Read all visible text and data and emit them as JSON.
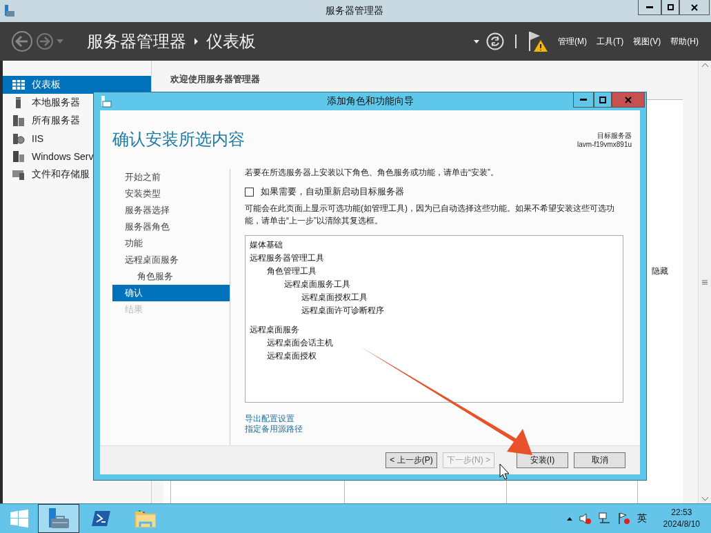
{
  "window": {
    "title": "服务器管理器"
  },
  "header": {
    "breadcrumb": [
      "服务器管理器",
      "仪表板"
    ],
    "menu": [
      "管理(M)",
      "工具(T)",
      "视图(V)",
      "帮助(H)"
    ]
  },
  "sidebar": {
    "items": [
      {
        "label": "仪表板",
        "kind": "dashboard",
        "selected": true
      },
      {
        "label": "本地服务器",
        "kind": "server",
        "selected": false
      },
      {
        "label": "所有服务器",
        "kind": "servers",
        "selected": false
      },
      {
        "label": "IIS",
        "kind": "iis",
        "selected": false
      },
      {
        "label": "Windows Serv",
        "kind": "roles",
        "selected": false
      },
      {
        "label": "文件和存储服",
        "kind": "storage",
        "selected": false
      }
    ]
  },
  "content": {
    "welcome": "欢迎使用服务器管理器",
    "hide_label": "隐藏"
  },
  "dialog": {
    "title": "添加角色和功能向导",
    "heading": "确认安装所选内容",
    "target_label": "目标服务器",
    "target_name": "lavm-f19vmx891u",
    "steps": [
      {
        "label": "开始之前",
        "selected": false,
        "disabled": false
      },
      {
        "label": "安装类型",
        "selected": false,
        "disabled": false
      },
      {
        "label": "服务器选择",
        "selected": false,
        "disabled": false
      },
      {
        "label": "服务器角色",
        "selected": false,
        "disabled": false
      },
      {
        "label": "功能",
        "selected": false,
        "disabled": false
      },
      {
        "label": "远程桌面服务",
        "selected": false,
        "disabled": false,
        "children": [
          {
            "label": "角色服务",
            "selected": false,
            "disabled": false
          }
        ]
      },
      {
        "label": "确认",
        "selected": true,
        "disabled": false
      },
      {
        "label": "结果",
        "selected": false,
        "disabled": true
      }
    ],
    "instruction": "若要在所选服务器上安装以下角色、角色服务或功能，请单击“安装”。",
    "restart_checkbox": {
      "label": "如果需要，自动重新启动目标服务器",
      "checked": false
    },
    "note": "可能会在此页面上显示可选功能(如管理工具)，因为已自动选择这些功能。如果不希望安装这些可选功能，请单击“上一步”以清除其复选框。",
    "features": [
      {
        "label": "媒体基础"
      },
      {
        "label": "远程服务器管理工具",
        "children": [
          {
            "label": "角色管理工具",
            "children": [
              {
                "label": "远程桌面服务工具",
                "children": [
                  {
                    "label": "远程桌面授权工具"
                  },
                  {
                    "label": "远程桌面许可诊断程序"
                  }
                ]
              }
            ]
          }
        ]
      },
      {
        "label": "远程桌面服务",
        "children": [
          {
            "label": "远程桌面会话主机"
          },
          {
            "label": "远程桌面授权"
          }
        ]
      }
    ],
    "links": [
      "导出配置设置",
      "指定备用源路径"
    ],
    "buttons": [
      {
        "label": "< 上一步(P)",
        "disabled": false
      },
      {
        "label": "下一步(N) >",
        "disabled": true
      },
      {
        "label": "安装(I)",
        "disabled": false
      },
      {
        "label": "取消",
        "disabled": false
      }
    ]
  },
  "taskbar": {
    "apps": [
      {
        "kind": "server-manager",
        "selected": true
      },
      {
        "kind": "powershell",
        "selected": false
      },
      {
        "kind": "explorer",
        "selected": false
      }
    ],
    "tray": {
      "ime": "英",
      "time": "22:53",
      "date": "2024/8/10"
    }
  }
}
